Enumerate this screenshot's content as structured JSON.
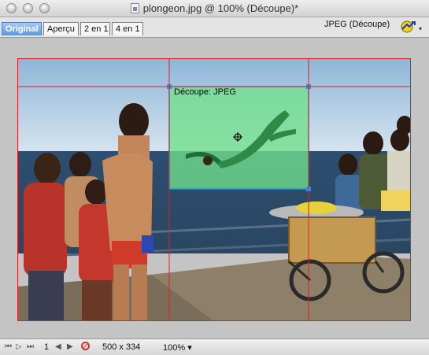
{
  "window": {
    "title": "plongeon.jpg @ 100% (Découpe)*"
  },
  "tabs": [
    {
      "label": "Original",
      "active": true
    },
    {
      "label": "Aperçu",
      "active": false
    },
    {
      "label": "2 en 1",
      "active": false
    },
    {
      "label": "4 en 1",
      "active": false
    }
  ],
  "toolbar": {
    "format_label": "JPEG (Découpe)",
    "optimize_icon": "optimize-arrow-icon"
  },
  "canvas": {
    "slice_label": "Découpe: JPEG",
    "slice_color": "#6fe08c",
    "slice_border_color": "#2f8ff0",
    "slice_line_color": "#e02020"
  },
  "statusbar": {
    "page_number": "1",
    "dimensions": "500 x 334",
    "zoom": "100%"
  }
}
